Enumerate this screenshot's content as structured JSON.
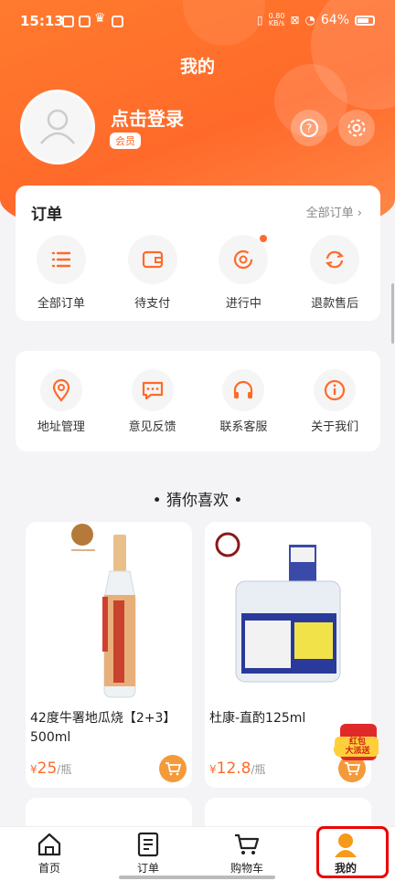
{
  "status_bar": {
    "time": "15:13",
    "speed": "0.80",
    "speed_unit": "KB/s",
    "battery": "64%"
  },
  "header": {
    "title": "我的"
  },
  "profile": {
    "login_text": "点击登录",
    "badge": "会员"
  },
  "orders": {
    "title": "订单",
    "view_all": "全部订单 ›",
    "items": [
      {
        "label": "全部订单",
        "icon": "list-icon"
      },
      {
        "label": "待支付",
        "icon": "wallet-icon"
      },
      {
        "label": "进行中",
        "icon": "in-progress-icon"
      },
      {
        "label": "退款售后",
        "icon": "refresh-icon"
      }
    ]
  },
  "services": [
    {
      "label": "地址管理",
      "icon": "location-icon"
    },
    {
      "label": "意见反馈",
      "icon": "feedback-icon"
    },
    {
      "label": "联系客服",
      "icon": "headphones-icon"
    },
    {
      "label": "关于我们",
      "icon": "info-icon"
    }
  ],
  "recommend": {
    "title": "• 猜你喜欢 •"
  },
  "products": [
    {
      "name": "42度牛署地瓜烧【2+3】500ml",
      "price_symbol": "¥",
      "price": "25",
      "unit": "/瓶"
    },
    {
      "name": "杜康-直酌125ml",
      "price_symbol": "¥",
      "price": "12.8",
      "unit": "/瓶"
    }
  ],
  "floating_badge": {
    "line1": "红包",
    "line2": "大派送"
  },
  "tabbar": [
    {
      "label": "首页",
      "icon": "home-icon"
    },
    {
      "label": "订单",
      "icon": "order-list-icon"
    },
    {
      "label": "购物车",
      "icon": "cart-icon"
    },
    {
      "label": "我的",
      "icon": "user-icon",
      "active": true
    }
  ],
  "colors": {
    "accent": "#ff6a2a",
    "background": "#f4f4f6",
    "highlight": "#ee0000"
  }
}
